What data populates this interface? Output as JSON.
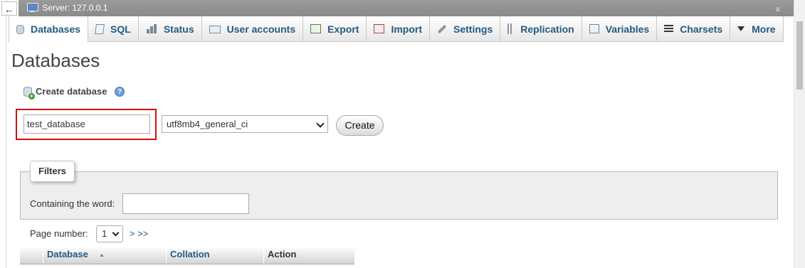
{
  "server_bar": {
    "title": "Server: 127.0.0.1",
    "back_glyph": "←",
    "collapse_glyph": "⌅"
  },
  "tabs": [
    {
      "label": "Databases",
      "icon": "database-icon",
      "active": true
    },
    {
      "label": "SQL",
      "icon": "sql-icon"
    },
    {
      "label": "Status",
      "icon": "status-icon"
    },
    {
      "label": "User accounts",
      "icon": "user-accounts-icon"
    },
    {
      "label": "Export",
      "icon": "export-icon"
    },
    {
      "label": "Import",
      "icon": "import-icon"
    },
    {
      "label": "Settings",
      "icon": "wrench-icon"
    },
    {
      "label": "Replication",
      "icon": "replication-icon"
    },
    {
      "label": "Variables",
      "icon": "variables-icon"
    },
    {
      "label": "Charsets",
      "icon": "charsets-icon"
    },
    {
      "label": "More",
      "icon": "triangle-down-icon"
    }
  ],
  "page": {
    "title": "Databases"
  },
  "create_database": {
    "heading": "Create database",
    "help_glyph": "?",
    "name_value": "test_database",
    "collation_value": "utf8mb4_general_ci",
    "create_label": "Create"
  },
  "filters": {
    "legend": "Filters",
    "containing_label": "Containing the word:",
    "containing_value": ""
  },
  "pagination": {
    "label": "Page number:",
    "selected": "1",
    "next": "> >>"
  },
  "table": {
    "columns": [
      "Database",
      "Collation",
      "Action"
    ]
  },
  "colors": {
    "link": "#235a81",
    "highlight": "#d20f0f",
    "serverbar": "#8f8f8f"
  }
}
